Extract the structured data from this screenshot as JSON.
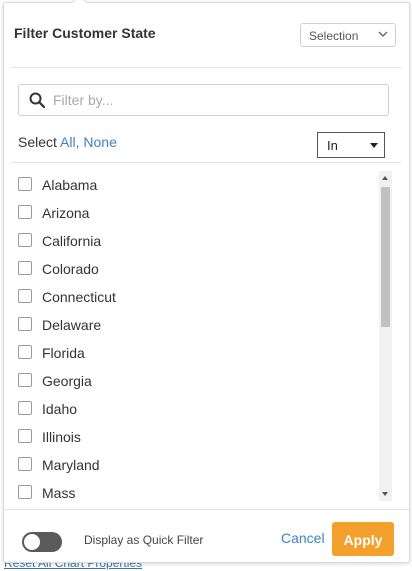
{
  "background": {
    "link_text": "Reset All Chart Properties"
  },
  "filter": {
    "title": "Filter Customer State",
    "mode_select": {
      "value": "Selection",
      "icon": "chevron-down-icon"
    },
    "search": {
      "placeholder": "Filter by...",
      "value": "",
      "icon": "search-icon"
    },
    "select_row": {
      "label": "Select",
      "all_link": "All,",
      "none_link": "None"
    },
    "operator_select": {
      "value": "In"
    },
    "items": [
      {
        "label": "Alabama",
        "checked": false
      },
      {
        "label": "Arizona",
        "checked": false
      },
      {
        "label": "California",
        "checked": false
      },
      {
        "label": "Colorado",
        "checked": false
      },
      {
        "label": "Connecticut",
        "checked": false
      },
      {
        "label": "Delaware",
        "checked": false
      },
      {
        "label": "Florida",
        "checked": false
      },
      {
        "label": "Georgia",
        "checked": false
      },
      {
        "label": "Idaho",
        "checked": false
      },
      {
        "label": "Illinois",
        "checked": false
      },
      {
        "label": "Maryland",
        "checked": false
      },
      {
        "label": "Mass",
        "checked": false
      }
    ],
    "footer": {
      "quick_filter_label": "Display as Quick Filter",
      "quick_filter_on": false,
      "cancel_label": "Cancel",
      "apply_label": "Apply"
    }
  },
  "colors": {
    "accent_link": "#3b82c4",
    "apply_button": "#f4a02c",
    "toggle_off": "#5a5a5a"
  }
}
